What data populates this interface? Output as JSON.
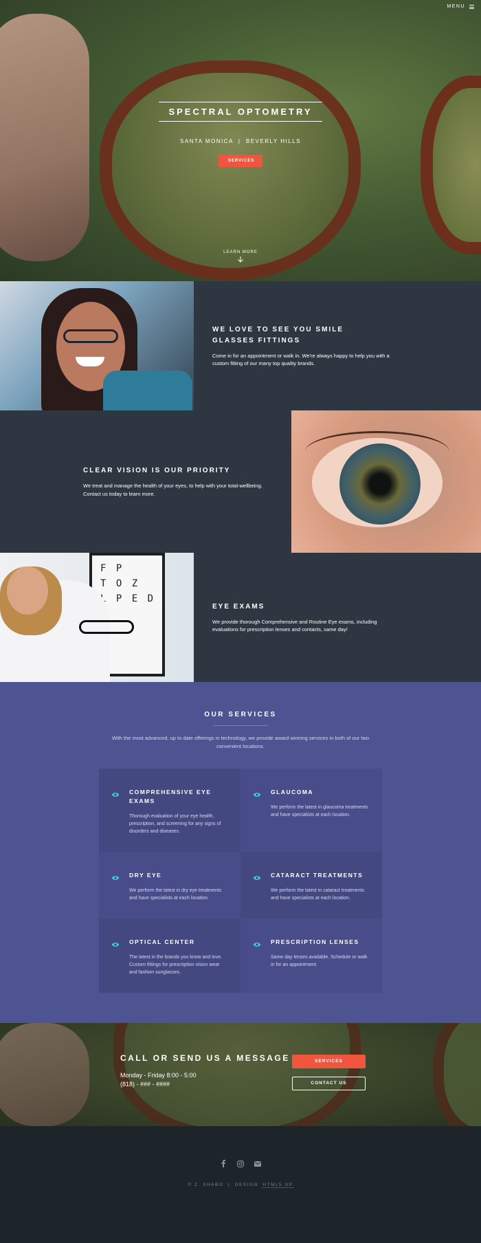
{
  "header": {
    "menu_label": "MENU"
  },
  "hero": {
    "title": "SPECTRAL OPTOMETRY",
    "subtitle": "SANTA MONICA  |  BEVERLY HILLS",
    "button_label": "SERVICES",
    "learn_more": "LEARN MORE"
  },
  "spotlights": [
    {
      "title_line1": "WE LOVE TO SEE YOU SMILE",
      "title_line2": "GLASSES FITTINGS",
      "text": "Come in for an appointment or walk in. We're always happy to help you with a custom fitting of our many top quality brands."
    },
    {
      "title": "CLEAR VISION IS OUR PRIORITY",
      "text": "We treat and manage the health of your eyes, to help with your total-wellbeing. Contact us today to learn more."
    },
    {
      "title": "EYE EXAMS",
      "text": "We provide thorough Comprehensive and Routine Eye exams, including evaluations for prescription lenses and contacts, same day!",
      "chart_text": "F P\nT O Z\nL P E D"
    }
  ],
  "services": {
    "title": "OUR SERVICES",
    "intro": "With the most advanced, up to date offerings in technology, we provide award winning services in both of our two convenient locations.",
    "items": [
      {
        "title": "COMPREHENSIVE EYE EXAMS",
        "text": "Thorough evaluation of your eye health, prescription, and screening for any signs of disorders and diseases."
      },
      {
        "title": "GLAUCOMA",
        "text": "We perform the latest in glaucoma treatments and have specialists at each location."
      },
      {
        "title": "DRY EYE",
        "text": "We perform the latest in dry eye treatments and have specialists at each location."
      },
      {
        "title": "CATARACT TREATMENTS",
        "text": "We perform the latest in cataract treatments and have specialists at each location."
      },
      {
        "title": "OPTICAL CENTER",
        "text": "The latest in the brands you know and love. Custom fittings for prescription vision wear and fashion sunglasses."
      },
      {
        "title": "PRESCRIPTION LENSES",
        "text": "Same day lenses available. Schedule or walk in for an appointment."
      }
    ],
    "icon": "eye-icon",
    "icon_color": "#3fd5d8"
  },
  "cta": {
    "title": "CALL OR SEND US A MESSAGE",
    "hours": "Monday - Friday 8:00 - 5:00",
    "phone": "(818) - ### - ####",
    "services_button": "SERVICES",
    "contact_button": "CONTACT US"
  },
  "footer": {
    "copyright_prefix": "© Z. SHABO  |  DESIGN: ",
    "design_link": "HTML5 UP",
    "social": [
      "facebook-icon",
      "instagram-icon",
      "email-icon"
    ]
  },
  "colors": {
    "accent": "#f2553d",
    "services_bg": "#4e5391",
    "spotlight_bg": "#2e3641",
    "footer_bg": "#1d242a"
  }
}
